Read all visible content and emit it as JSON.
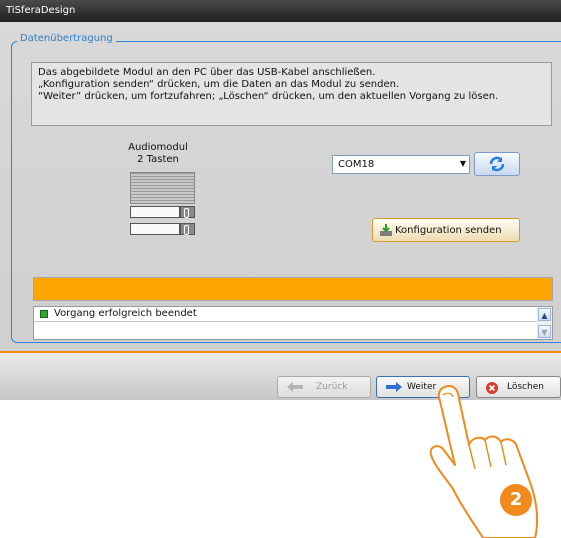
{
  "window": {
    "title": "TiSferaDesign"
  },
  "group": {
    "legend": "Datenübertragung"
  },
  "info": {
    "lines": [
      "Das abgebildete Modul an den PC über das USB-Kabel anschließen.",
      "„Konfiguration senden“ drücken, um die Daten an das Modul zu senden.",
      "“Weiter” drücken, um fortzufahren; „Löschen“ drücken, um den aktuellen Vorgang zu lösen."
    ]
  },
  "module": {
    "title_line1": "Audiomodul",
    "title_line2": "2 Tasten"
  },
  "port": {
    "selected": "COM18"
  },
  "send_button": {
    "label": "Konfiguration senden"
  },
  "progress": {
    "value_percent": 100,
    "color": "#ffa500"
  },
  "status": {
    "message": "Vorgang erfolgreich beendet",
    "color": "#2fa82f"
  },
  "footer": {
    "back_label": "Zurück",
    "next_label": "Weiter",
    "delete_label": "Löschen"
  },
  "step_badge": "2",
  "colors": {
    "accent": "#f08a1c",
    "group_border": "#2f86d8"
  },
  "icons": [
    "refresh-icon",
    "send-config-icon",
    "back-arrow-icon",
    "next-arrow-icon",
    "delete-icon",
    "status-ok-icon",
    "scroll-up-icon",
    "scroll-down-icon"
  ]
}
